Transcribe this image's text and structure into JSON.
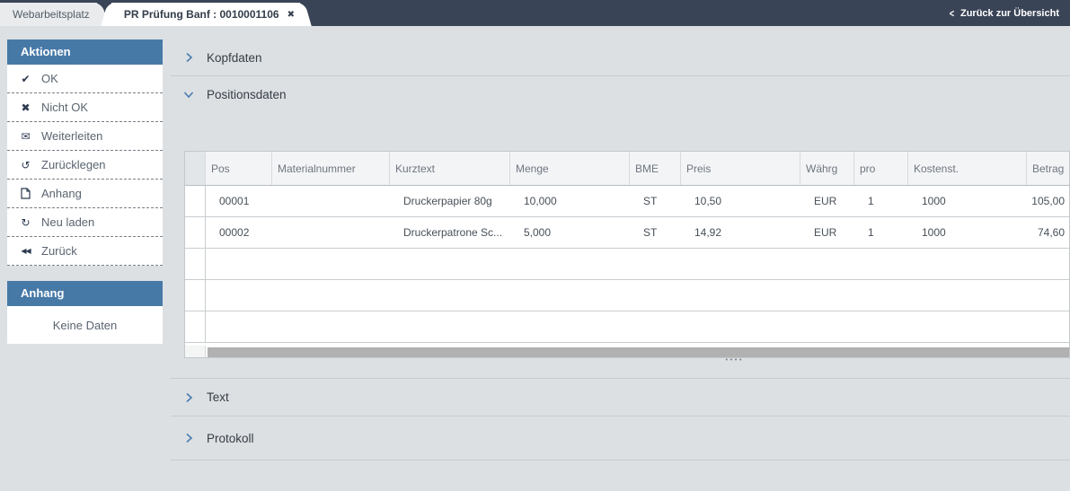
{
  "topbar": {
    "tabs": [
      {
        "label": "Webarbeitsplatz",
        "active": false
      },
      {
        "label": "PR Prüfung Banf : 0010001106",
        "active": true
      }
    ],
    "back_link_label": "Zurück zur Übersicht"
  },
  "icons": {
    "ok_check": "✔",
    "nicht_ok_x": "✖",
    "weiterleiten_envelope": "✉",
    "zuruecklegen_undo": "↺",
    "neu_laden_refresh": "↻",
    "zurueck_rewind": "◀◀",
    "tab_close": "✖",
    "back_chevron": "<",
    "grip_dots": "••••"
  },
  "colors": {
    "topbar_background": "#3a4457",
    "panel_header_blue": "#4779a7",
    "accent_chevron_blue": "#4a7cb0",
    "page_background": "#dce0e3",
    "scrollbar_thumb": "#b1b1b1"
  },
  "sidebar": {
    "actions_panel": {
      "title": "Aktionen",
      "items": [
        {
          "icon": "check",
          "label": "OK"
        },
        {
          "icon": "x",
          "label": "Nicht OK"
        },
        {
          "icon": "envelope",
          "label": "Weiterleiten"
        },
        {
          "icon": "undo",
          "label": "Zurücklegen"
        },
        {
          "icon": "document",
          "label": "Anhang"
        },
        {
          "icon": "refresh",
          "label": "Neu laden"
        },
        {
          "icon": "rewind",
          "label": "Zurück"
        }
      ]
    },
    "attachment_panel": {
      "title": "Anhang",
      "empty_text": "Keine Daten"
    }
  },
  "main": {
    "sections": [
      {
        "label": "Kopfdaten",
        "expanded": false
      },
      {
        "label": "Positionsdaten",
        "expanded": true
      },
      {
        "label": "Text",
        "expanded": false
      },
      {
        "label": "Protokoll",
        "expanded": false
      }
    ],
    "table": {
      "columns": [
        "Pos",
        "Materialnummer",
        "Kurztext",
        "Menge",
        "BME",
        "Preis",
        "Währg",
        "pro",
        "Kostenst.",
        "Betrag"
      ],
      "rows": [
        {
          "pos": "00001",
          "materialnummer": "",
          "kurztext": "Druckerpapier 80g",
          "menge": "10,000",
          "bme": "ST",
          "preis": "10,50",
          "waehrg": "EUR",
          "pro": "1",
          "kostenst": "1000",
          "betrag": "105,00"
        },
        {
          "pos": "00002",
          "materialnummer": "",
          "kurztext": "Druckerpatrone Sc...",
          "menge": "5,000",
          "bme": "ST",
          "preis": "14,92",
          "waehrg": "EUR",
          "pro": "1",
          "kostenst": "1000",
          "betrag": "74,60"
        }
      ],
      "empty_row_count": 3
    }
  }
}
